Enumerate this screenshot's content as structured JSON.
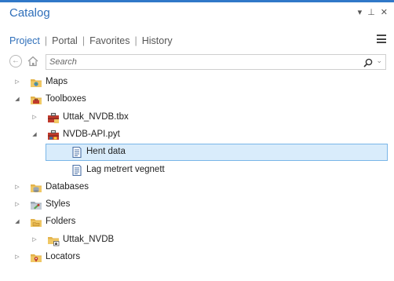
{
  "pane": {
    "title": "Catalog",
    "buttons": {
      "dropdown": "▾",
      "pin": "⊥",
      "close": "✕"
    }
  },
  "tabs": [
    "Project",
    "Portal",
    "Favorites",
    "History"
  ],
  "active_tab": "Project",
  "search": {
    "placeholder": "Search",
    "value": ""
  },
  "tree": [
    {
      "label": "Maps",
      "level": 0,
      "expanded": false,
      "icon": "maps-folder-icon"
    },
    {
      "label": "Toolboxes",
      "level": 0,
      "expanded": true,
      "icon": "toolboxes-folder-icon"
    },
    {
      "label": "Uttak_NVDB.tbx",
      "level": 1,
      "expanded": false,
      "icon": "toolbox-icon"
    },
    {
      "label": "NVDB-API.pyt",
      "level": 1,
      "expanded": true,
      "icon": "python-toolbox-icon"
    },
    {
      "label": "Hent data",
      "level": 2,
      "expanded": null,
      "icon": "script-tool-icon",
      "selected": true
    },
    {
      "label": "Lag metrert vegnett",
      "level": 2,
      "expanded": null,
      "icon": "script-tool-icon"
    },
    {
      "label": "Databases",
      "level": 0,
      "expanded": false,
      "icon": "databases-folder-icon"
    },
    {
      "label": "Styles",
      "level": 0,
      "expanded": false,
      "icon": "styles-folder-icon"
    },
    {
      "label": "Folders",
      "level": 0,
      "expanded": true,
      "icon": "folders-folder-icon"
    },
    {
      "label": "Uttak_NVDB",
      "level": 1,
      "expanded": false,
      "icon": "folder-connection-icon"
    },
    {
      "label": "Locators",
      "level": 0,
      "expanded": false,
      "icon": "locators-folder-icon"
    }
  ],
  "colors": {
    "accent": "#2f6fba",
    "folder": "#e3b34b",
    "selection_fill": "#d9ecfb",
    "selection_border": "#7ab6e8"
  }
}
